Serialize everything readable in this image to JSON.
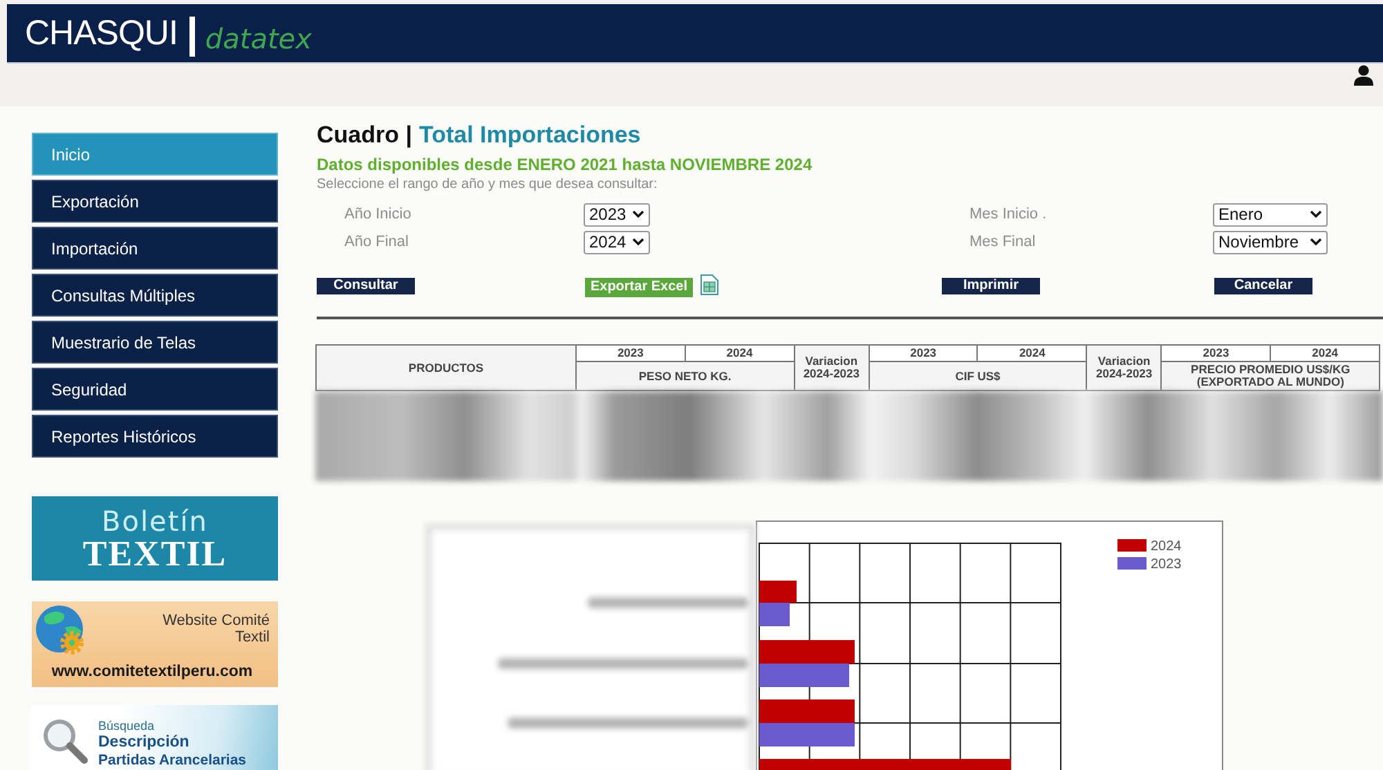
{
  "header": {
    "logo": "CHASQUI",
    "product": "datatex"
  },
  "sidebar": {
    "items": [
      {
        "label": "Inicio",
        "selected": true
      },
      {
        "label": "Exportación",
        "selected": false
      },
      {
        "label": "Importación",
        "selected": false
      },
      {
        "label": "Consultas Múltiples",
        "selected": false
      },
      {
        "label": "Muestrario de Telas",
        "selected": false
      },
      {
        "label": "Seguridad",
        "selected": false
      },
      {
        "label": "Reportes Históricos",
        "selected": false
      }
    ],
    "banners": [
      {
        "kind": "bulletin",
        "lines": [
          "Boletín",
          "TEXTIL"
        ]
      },
      {
        "kind": "website",
        "lines": [
          "Website Comité",
          "Textil",
          "www.comitetextilperu.com"
        ]
      },
      {
        "kind": "search",
        "lines": [
          "Búsqueda",
          "Descripción",
          "Partidas Arancelarias"
        ]
      }
    ]
  },
  "page": {
    "title_prefix": "Cuadro |",
    "title": "Total Importaciones",
    "availability": "Datos disponibles desde ENERO 2021 hasta NOVIEMBRE 2024",
    "instruction": "Seleccione el rango de año y mes que desea consultar:"
  },
  "filters": [
    {
      "label": "Año Inicio",
      "value": "2023"
    },
    {
      "label": "Mes Inicio .",
      "value": "Enero"
    },
    {
      "label": "Año Final",
      "value": "2024"
    },
    {
      "label": "Mes Final",
      "value": "Noviembre"
    }
  ],
  "buttons": [
    {
      "label": "Consultar",
      "kind": "query"
    },
    {
      "label": "Exportar Excel",
      "kind": "export"
    },
    {
      "label": "Imprimir",
      "kind": "print"
    },
    {
      "label": "Cancelar",
      "kind": "cancel"
    }
  ],
  "table": {
    "groups": [
      {
        "kind": "single",
        "label": "PRODUCTOS"
      },
      {
        "kind": "years",
        "label": "PESO NETO KG.",
        "years": [
          "2023",
          "2024"
        ]
      },
      {
        "kind": "single",
        "label": "Variacion 2024-2023"
      },
      {
        "kind": "years",
        "label": "CIF US$",
        "years": [
          "2023",
          "2024"
        ]
      },
      {
        "kind": "single",
        "label": "Variacion 2024-2023"
      },
      {
        "kind": "years",
        "label": "PRECIO PROMEDIO US$/KG (EXPORTADO AL MUNDO)",
        "years": [
          "2023",
          "2024"
        ]
      }
    ]
  },
  "chart": {
    "legend": [
      {
        "label": "2024",
        "color": "#c00000"
      },
      {
        "label": "2023",
        "color": "#6a5acd"
      }
    ]
  }
}
